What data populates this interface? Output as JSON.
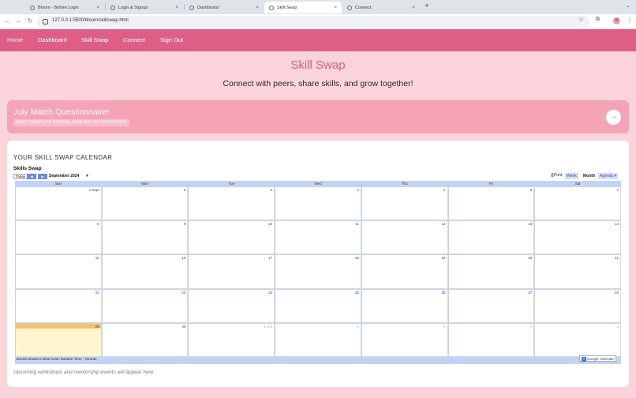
{
  "browser": {
    "tabs": [
      {
        "label": "Bloom - Before Login"
      },
      {
        "label": "Login & Signup"
      },
      {
        "label": "Dashboard"
      },
      {
        "label": "Skill Swap"
      },
      {
        "label": "Connect"
      }
    ],
    "close_glyph": "×",
    "new_tab_glyph": "+",
    "url": "127.0.0.1:5500/bloom/skillswap.html",
    "profile_initial": "N"
  },
  "nav": {
    "items": [
      "Home",
      "Dashboard",
      "Skill Swap",
      "Connect",
      "Sign Out"
    ]
  },
  "hero": {
    "title": "Skill Swap",
    "subtitle": "Connect with peers, share skills, and grow together!"
  },
  "banner": {
    "title": "July Match Questionnaire!",
    "badge": "MUST COMPLETE BEFORE JUNE 30th TO PARTICIPATE",
    "arrow": "→"
  },
  "calendar_card": {
    "title": "YOUR SKILL SWAP CALENDAR",
    "note": "Upcoming workshops and mentorship events will appear here."
  },
  "calendar": {
    "name": "Skills Swap",
    "today_label": "Today",
    "prev_glyph": "◀",
    "next_glyph": "▶",
    "month_label": "September 2024",
    "month_dropdown": "▼",
    "print_label": "Print",
    "views": {
      "week": "Week",
      "month": "Month",
      "agenda": "Agenda"
    },
    "weekdays": [
      "Sun",
      "Mon",
      "Tue",
      "Wed",
      "Thu",
      "Fri",
      "Sat"
    ],
    "weeks": [
      [
        "1 Sept",
        "2",
        "3",
        "4",
        "5",
        "6",
        "7"
      ],
      [
        "8",
        "9",
        "10",
        "11",
        "12",
        "13",
        "14"
      ],
      [
        "15",
        "16",
        "17",
        "18",
        "19",
        "20",
        "21"
      ],
      [
        "22",
        "23",
        "24",
        "25",
        "26",
        "27",
        "28"
      ],
      [
        "29",
        "30",
        "1 Oct",
        "2",
        "3",
        "4",
        "5"
      ]
    ],
    "timezone_note": "Events shown in time zone: Eastern Time - Toronto",
    "google_label": "Google Calendar"
  },
  "colors": {
    "brand_pink": "#de5e86",
    "page_bg": "#fbd3da",
    "banner_bg": "#f5a4b7",
    "today_highlight": "#f5c16a"
  }
}
